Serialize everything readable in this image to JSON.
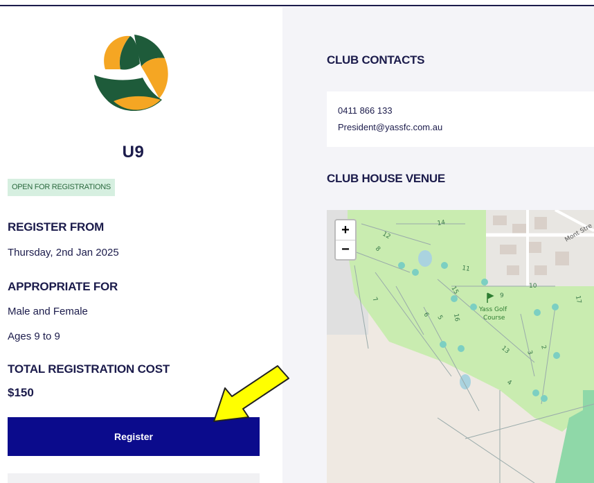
{
  "team": {
    "name": "U9",
    "status": "OPEN FOR REGISTRATIONS"
  },
  "register_from": {
    "label": "REGISTER FROM",
    "value": "Thursday, 2nd Jan 2025"
  },
  "appropriate_for": {
    "label": "APPROPRIATE FOR",
    "gender": "Male and Female",
    "ages": "Ages 9 to 9"
  },
  "cost": {
    "label": "TOTAL REGISTRATION COST",
    "value": "$150"
  },
  "register_button": {
    "label": "Register"
  },
  "club_contacts": {
    "title": "CLUB CONTACTS",
    "phone": "0411 866 133",
    "email": "President@yassfc.com.au"
  },
  "club_house": {
    "title": "CLUB HOUSE VENUE"
  },
  "map": {
    "zoom_in": "+",
    "zoom_out": "−",
    "place_name_line1": "Yass Golf",
    "place_name_line2": "Course",
    "street_label": "Mont Stre",
    "hole_labels": [
      "14",
      "12",
      "8",
      "11",
      "10",
      "9",
      "15",
      "7",
      "6",
      "5",
      "16",
      "13",
      "3",
      "2",
      "4",
      "17"
    ]
  },
  "colors": {
    "navy": "#1b1b4b",
    "button": "#0b0b8c",
    "badge_bg": "#d6efe0",
    "golf_green": "#c9ecb0",
    "arrow": "#ffff00"
  }
}
